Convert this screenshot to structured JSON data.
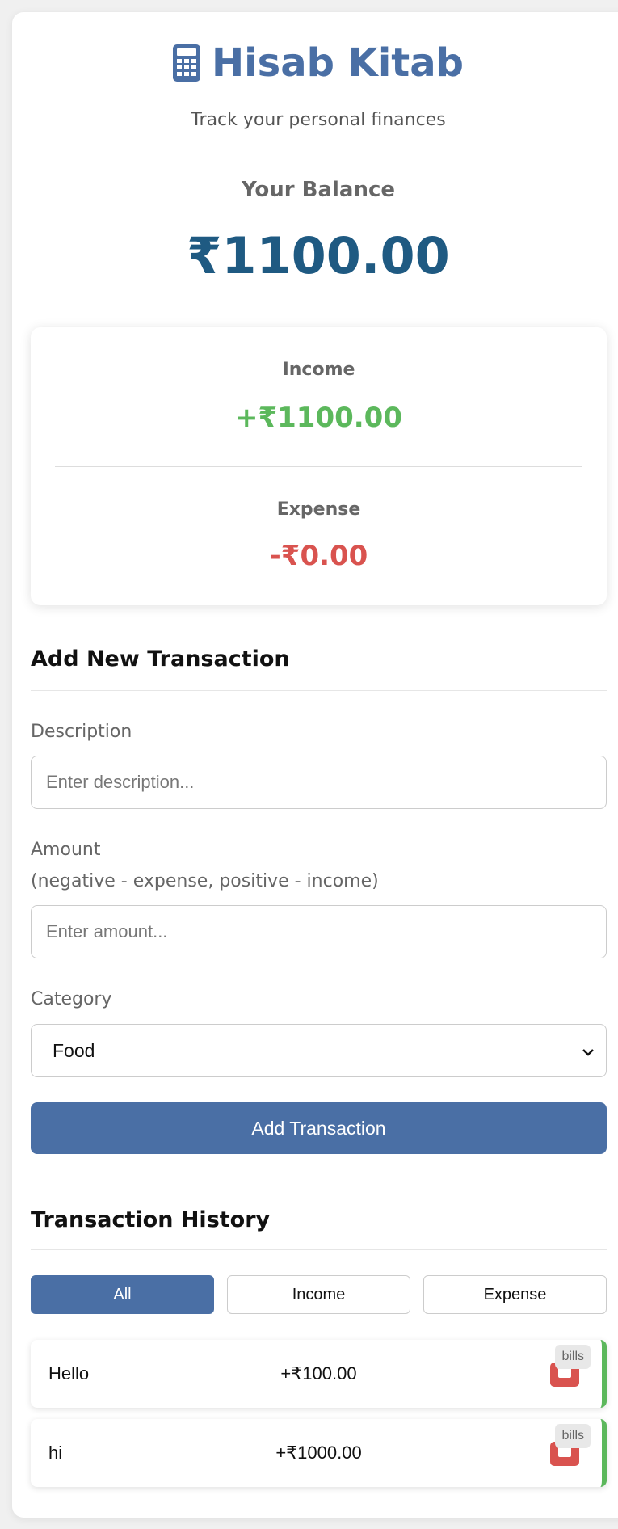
{
  "app": {
    "title": "Hisab Kitab",
    "subtitle": "Track your personal finances"
  },
  "balance": {
    "label": "Your Balance",
    "amount": "₹1100.00"
  },
  "summary": {
    "income_label": "Income",
    "income_value": "+₹1100.00",
    "expense_label": "Expense",
    "expense_value": "-₹0.00"
  },
  "form": {
    "heading": "Add New Transaction",
    "description_label": "Description",
    "description_placeholder": "Enter description...",
    "amount_label": "Amount",
    "amount_hint": "(negative - expense, positive - income)",
    "amount_placeholder": "Enter amount...",
    "category_label": "Category",
    "category_selected": "Food",
    "submit_label": "Add Transaction"
  },
  "history": {
    "heading": "Transaction History",
    "filters": [
      {
        "label": "All",
        "active": true
      },
      {
        "label": "Income",
        "active": false
      },
      {
        "label": "Expense",
        "active": false
      }
    ],
    "transactions": [
      {
        "description": "Hello",
        "amount": "+₹100.00",
        "category": "bills"
      },
      {
        "description": "hi",
        "amount": "+₹1000.00",
        "category": "bills"
      }
    ]
  },
  "colors": {
    "accent": "#4a6fa5",
    "balance": "#1f5a82",
    "income": "#5cb85c",
    "expense": "#d9534f"
  },
  "icons": {
    "title_icon": "calculator-icon",
    "select_icon": "chevron-down-icon",
    "delete_icon": "trash-icon"
  }
}
